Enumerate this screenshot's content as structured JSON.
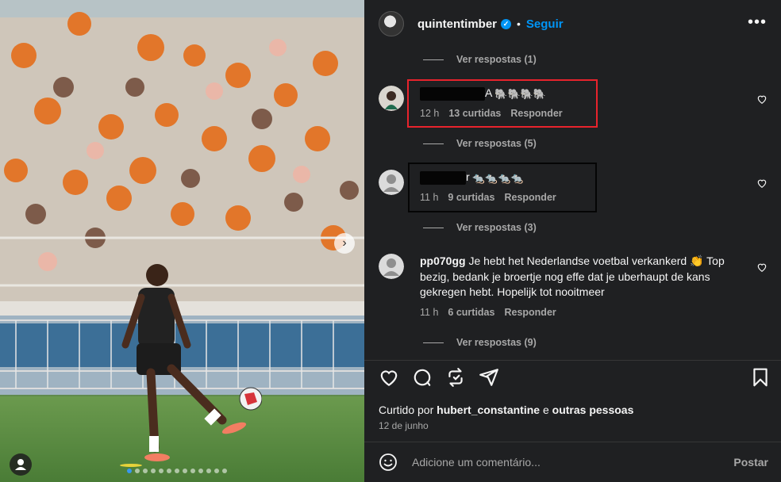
{
  "post": {
    "username": "quintentimber",
    "separator": "•",
    "follow_label": "Seguir",
    "more_label": "•••",
    "liked_by_prefix": "Curtido por",
    "liked_by_user": "hubert_constantine",
    "liked_by_and": "e",
    "liked_by_others": "outras pessoas",
    "date": "12 de junho",
    "carousel_total": 13,
    "carousel_index": 1
  },
  "replies": {
    "r1": "Ver respostas (1)",
    "r2": "Ver respostas (5)",
    "r3": "Ver respostas (3)",
    "r4": "Ver respostas (9)"
  },
  "comments": [
    {
      "username_redacted": "A",
      "emojis": "🐘🐘🐘🐘",
      "time": "12 h",
      "likes": "13 curtidas",
      "reply": "Responder",
      "highlight": "#e8232c"
    },
    {
      "username_redacted": "r",
      "emojis": "🐀🐀🐀🐀",
      "time": "11 h",
      "likes": "9 curtidas",
      "reply": "Responder",
      "highlight": "#050505"
    },
    {
      "username": "pp070gg",
      "text": "Je hebt het Nederlandse voetbal verkankerd 👏 Top bezig, bedank je broertje nog effe dat je uberhaupt de kans gekregen hebt. Hopelijk tot nooitmeer",
      "time": "11 h",
      "likes": "6 curtidas",
      "reply": "Responder"
    }
  ],
  "composer": {
    "placeholder": "Adicione um comentário...",
    "post_label": "Postar"
  },
  "icons": {
    "like": "heart-icon",
    "comment": "comment-bubble-icon",
    "repost": "repost-icon",
    "share": "paper-plane-icon",
    "save": "bookmark-icon",
    "emoji": "smiley-icon",
    "next": "chevron-right-icon",
    "tag": "user-tag-icon"
  },
  "colors": {
    "accent": "#0095f6",
    "panel_bg": "#1f2022",
    "muted_text": "#a8a8a8"
  }
}
